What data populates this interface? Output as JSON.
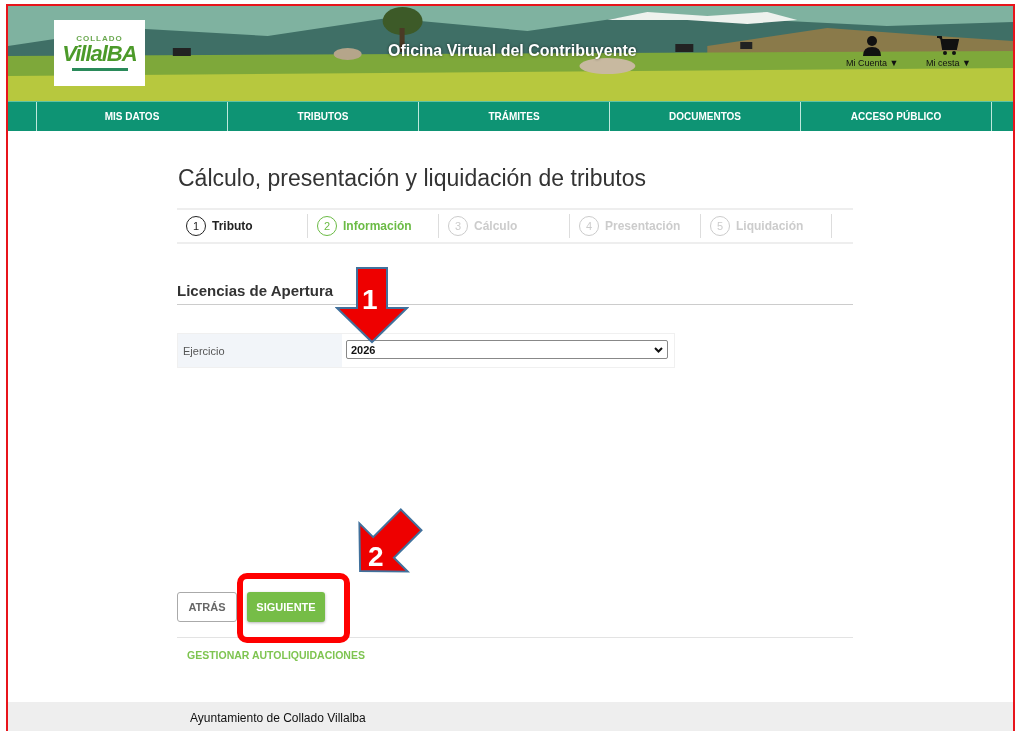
{
  "header": {
    "logo": {
      "top": "COLLADO",
      "main": "VillalBA"
    },
    "title": "Oficina Virtual del Contribuyente",
    "account_menu": "Mi Cuenta ▼",
    "cart_menu": "Mi cesta ▼"
  },
  "nav": [
    {
      "label": "MIS DATOS"
    },
    {
      "label": "TRIBUTOS"
    },
    {
      "label": "TRÁMITES"
    },
    {
      "label": "DOCUMENTOS"
    },
    {
      "label": "ACCESO PÚBLICO"
    }
  ],
  "page_title": "Cálculo, presentación y liquidación de tributos",
  "steps": [
    {
      "number": "1",
      "label": "Tributo",
      "completed": true,
      "selected": false
    },
    {
      "number": "2",
      "label": "Información",
      "completed": false,
      "selected": true
    },
    {
      "number": "3",
      "label": "Cálculo",
      "completed": false,
      "selected": false
    },
    {
      "number": "4",
      "label": "Presentación",
      "completed": false,
      "selected": false
    },
    {
      "number": "5",
      "label": "Liquidación",
      "completed": false,
      "selected": false
    }
  ],
  "section_title": "Licencias de Apertura",
  "form": [
    {
      "label": "Ejercicio",
      "value": "2026"
    }
  ],
  "buttons": [
    {
      "label": "ATRÁS",
      "kind": "secondary"
    },
    {
      "label": "SIGUIENTE",
      "kind": "primary"
    }
  ],
  "link": "GESTIONAR AUTOLIQUIDACIONES",
  "footer": {
    "title": "Ayuntamiento de Collado Villalba"
  },
  "annotations": [
    {
      "kind": "arrow-down",
      "label": "1"
    },
    {
      "kind": "arrow-diagonal",
      "label": "2"
    },
    {
      "kind": "highlight"
    }
  ]
}
